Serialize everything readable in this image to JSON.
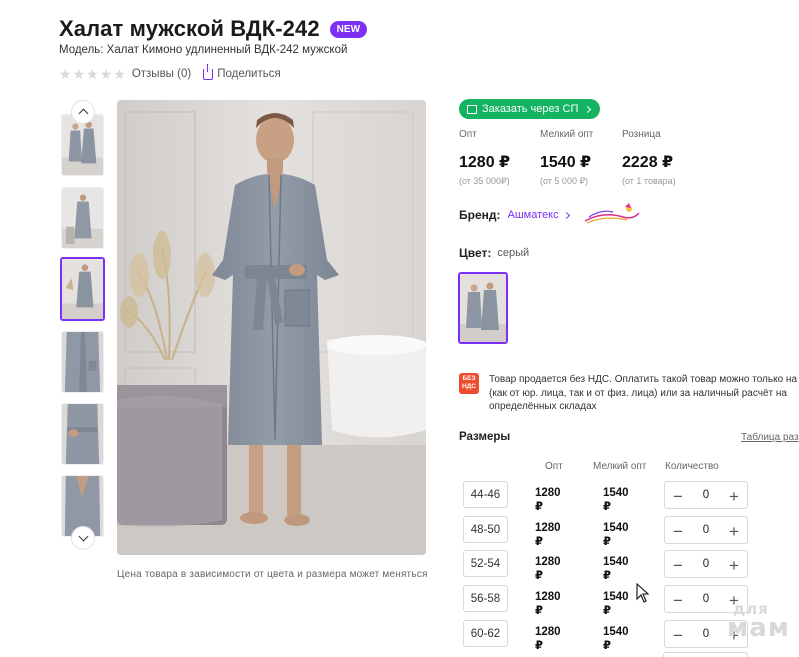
{
  "product": {
    "title": "Халат мужской ВДК-242",
    "badge": "NEW",
    "model": "Модель: Халат Кимоно удлиненный ВДК-242 мужской",
    "reviews": "Отзывы (0)",
    "share": "Поделиться",
    "rating_stars": 5,
    "rating_value": 0
  },
  "gallery": {
    "caption": "Цена товара в зависимости от цвета и размера может меняться",
    "thumb_count": 6,
    "active_index": 2
  },
  "order_button": {
    "label": "Заказать через СП"
  },
  "prices": [
    {
      "label": "Опт",
      "value": "1280 ₽",
      "sub": "(от 35 000₽)"
    },
    {
      "label": "Мелкий опт",
      "value": "1540 ₽",
      "sub": "(от 5 000 ₽)"
    },
    {
      "label": "Розница",
      "value": "2228 ₽",
      "sub": "(от 1 товара)"
    }
  ],
  "brand": {
    "label": "Бренд:",
    "name": "Ашматекс"
  },
  "color": {
    "label": "Цвет:",
    "value": "серый"
  },
  "vat": {
    "icon_text_1": "БЕЗ",
    "icon_text_2": "НДС",
    "text": "Товар продается без НДС. Оплатить такой товар можно только на (как от юр. лица, так и от физ. лица) или за наличный расчёт на определённых складах"
  },
  "sizes": {
    "title": "Размеры",
    "table_link": "Таблица раз",
    "headers": {
      "opt": "Опт",
      "small_opt": "Мелкий опт",
      "qty": "Количество"
    },
    "rows": [
      {
        "size": "44-46",
        "opt": "1280 ₽",
        "small_opt": "1540 ₽",
        "qty": "0"
      },
      {
        "size": "48-50",
        "opt": "1280 ₽",
        "small_opt": "1540 ₽",
        "qty": "0"
      },
      {
        "size": "52-54",
        "opt": "1280 ₽",
        "small_opt": "1540 ₽",
        "qty": "0"
      },
      {
        "size": "56-58",
        "opt": "1280 ₽",
        "small_opt": "1540 ₽",
        "qty": "0"
      },
      {
        "size": "60-62",
        "opt": "1280 ₽",
        "small_opt": "1540 ₽",
        "qty": "0"
      }
    ],
    "minus": "−",
    "plus": "+"
  },
  "watermark": {
    "top": "для",
    "bottom": "мам"
  },
  "colors": {
    "accent": "#7b2ff7",
    "green": "#13b361",
    "vat_red": "#ef4c2f"
  }
}
